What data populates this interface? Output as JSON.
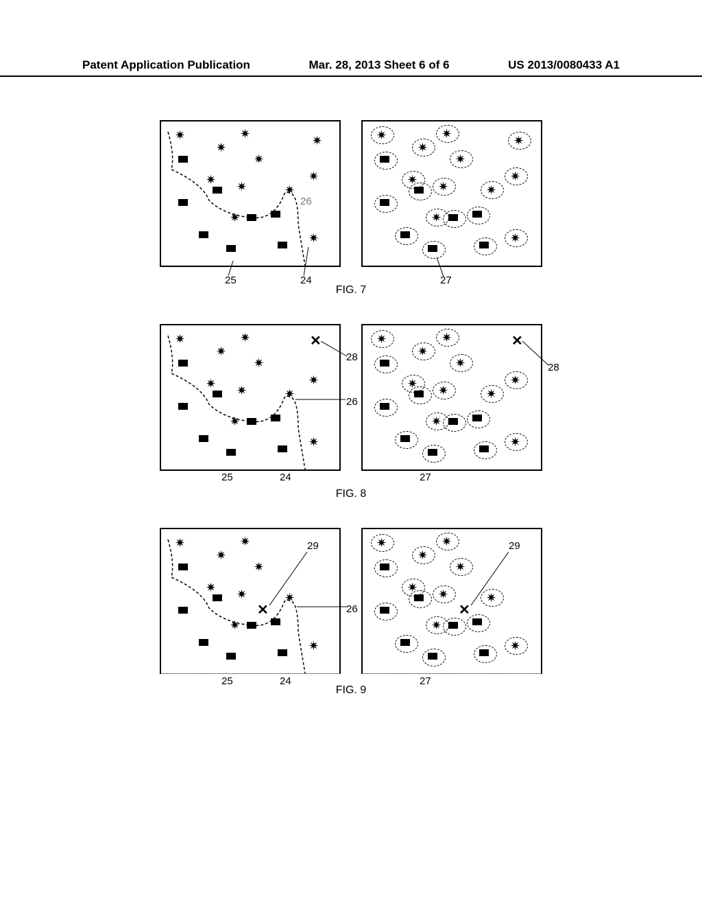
{
  "header": {
    "left": "Patent Application Publication",
    "center": "Mar. 28, 2013  Sheet 6 of 6",
    "right": "US 2013/0080433 A1"
  },
  "figures": {
    "fig7": {
      "caption": "FIG. 7",
      "labels": {
        "l24": "24",
        "l25": "25",
        "l26": "26",
        "l27": "27"
      }
    },
    "fig8": {
      "caption": "FIG. 8",
      "labels": {
        "l24": "24",
        "l25": "25",
        "l26": "26",
        "l27": "27",
        "l28a": "28",
        "l28b": "28"
      }
    },
    "fig9": {
      "caption": "FIG. 9",
      "labels": {
        "l24": "24",
        "l25": "25",
        "l26": "26",
        "l27": "27",
        "l29a": "29",
        "l29b": "29"
      }
    }
  }
}
